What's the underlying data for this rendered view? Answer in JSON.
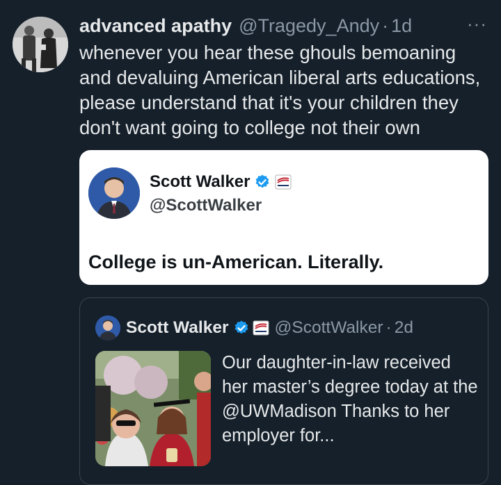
{
  "tweet": {
    "display_name": "advanced apathy",
    "handle": "@Tragedy_Andy",
    "separator": "·",
    "time": "1d",
    "more_icon": "more-horizontal-icon",
    "text": "whenever you hear these ghouls bemoaning and devaluing American liberal arts educations, please understand that it's your children they don't want going to college not their own"
  },
  "quote1": {
    "display_name": "Scott Walker",
    "handle": "@ScottWalker",
    "text": "College is un-American. Literally.",
    "verified_icon": "verified-badge-icon",
    "affiliation_icon": "flag-badge-icon"
  },
  "quote2": {
    "display_name": "Scott Walker",
    "handle": "@ScottWalker",
    "separator": "·",
    "time": "2d",
    "text": "Our daughter-in-law received her master’s degree today at the @UWMadison Thanks to her employer for..."
  },
  "colors": {
    "background": "#15202b",
    "primary_text": "#e7e9ea",
    "secondary_text": "#8b98a5",
    "verified_blue": "#1d9bf0",
    "quote_card_bg": "#ffffff",
    "border": "#38444d"
  }
}
